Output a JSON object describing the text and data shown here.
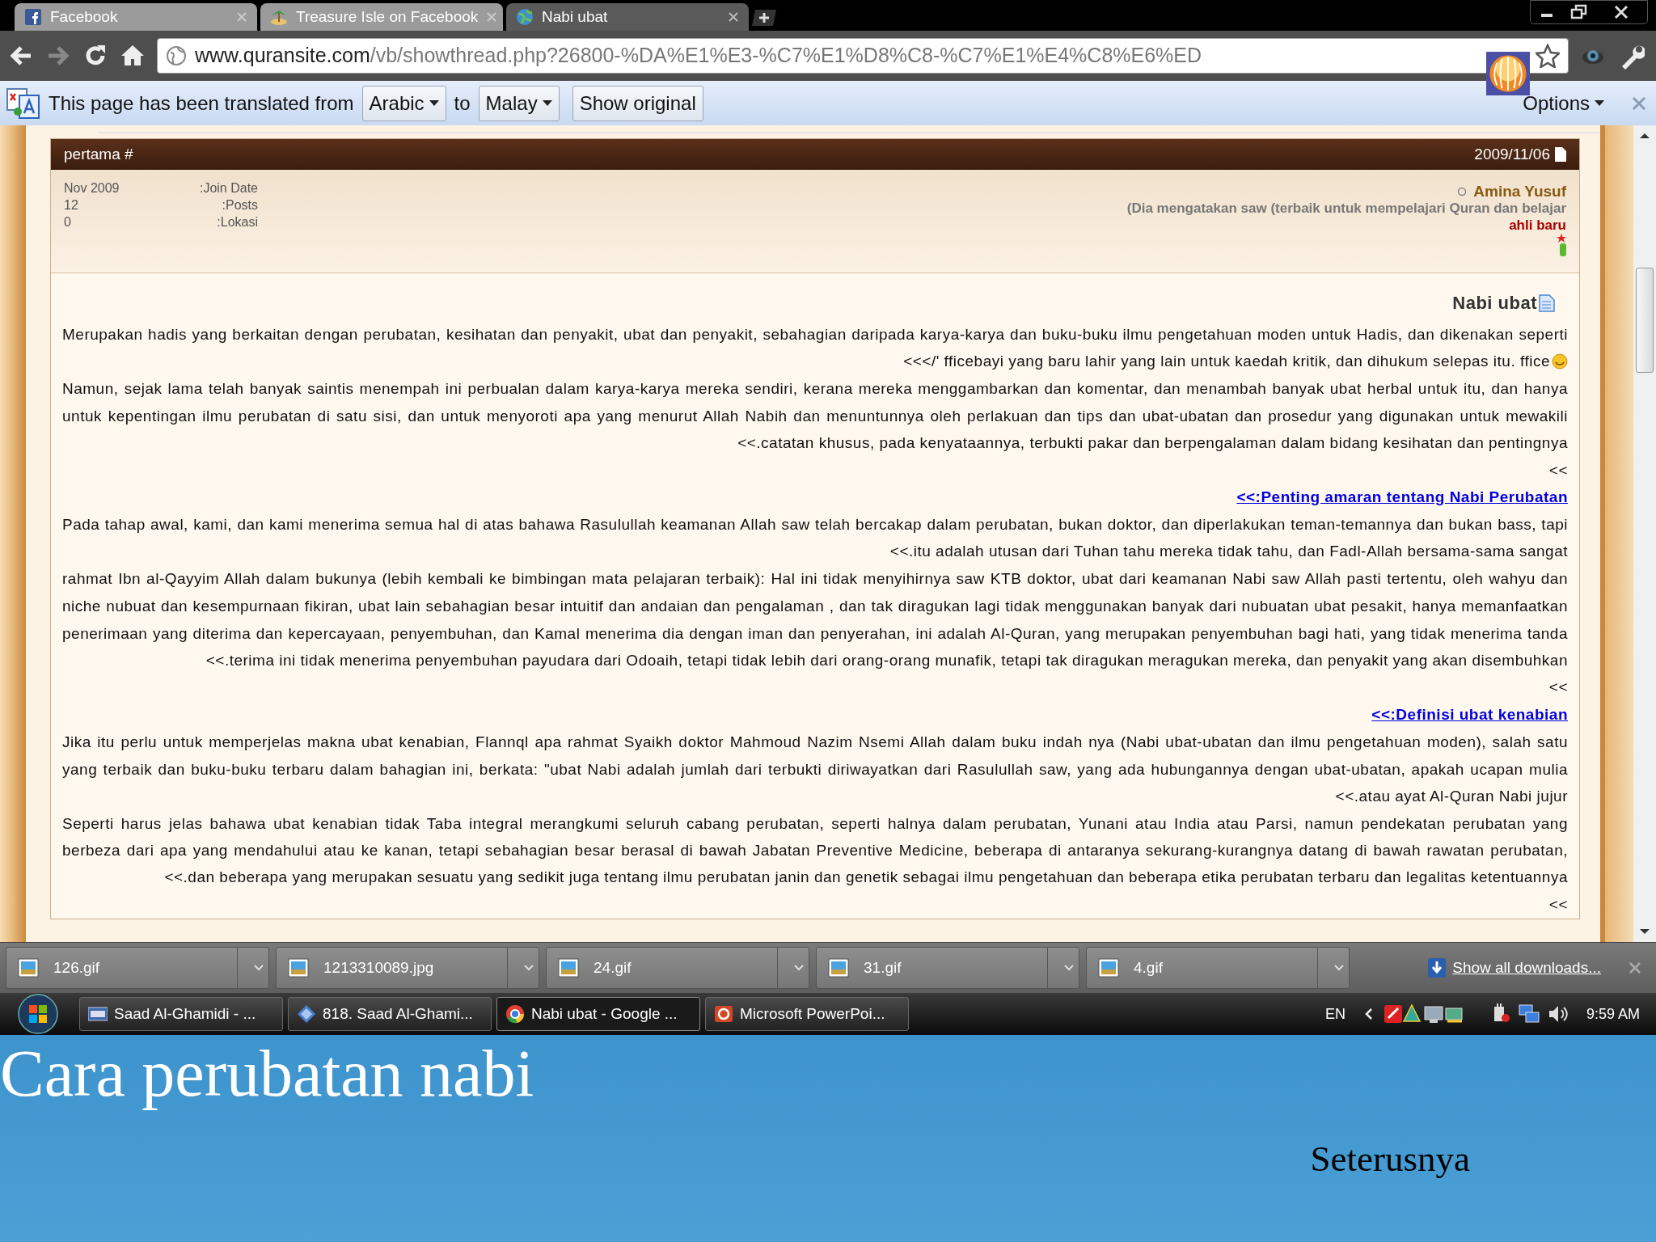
{
  "browser": {
    "tabs": [
      {
        "label": "Facebook",
        "selected": false
      },
      {
        "label": "Treasure Isle on Facebook",
        "selected": false
      },
      {
        "label": "Nabi ubat",
        "selected": true
      }
    ],
    "address": {
      "host": "www.quransite.com",
      "path": "/vb/showthread.php?26800-%DA%E1%E3-%C7%E1%D8%C8-%C7%E1%E4%C8%E6%ED"
    },
    "translate_bar": {
      "message": "This page has been translated from",
      "from": "Arabic",
      "connector": "to",
      "to": "Malay",
      "show_original": "Show original",
      "options": "Options"
    }
  },
  "post": {
    "number": "pertama #",
    "date": "2009/11/06",
    "user_info": [
      {
        "value": "Nov 2009",
        "label": ":Join Date"
      },
      {
        "value": "12",
        "label": ":Posts"
      },
      {
        "value": "0",
        "label": ":Lokasi"
      }
    ],
    "username": "Amina Yusuf",
    "user_title": "(Dia mengatakan saw (terbaik untuk mempelajari Quran dan belajar",
    "rank": "ahli baru",
    "title": "Nabi ubat",
    "lines": [
      {
        "kind": "full",
        "text": "Merupakan hadis yang berkaitan dengan perubatan, kesihatan dan penyakit, ubat dan penyakit, sebahagian daripada karya-karya dan buku-buku ilmu pengetahuan moden untuk Hadis, dan dikenakan seperti"
      },
      {
        "kind": "end",
        "text": "<<</' fficebayi yang baru lahir yang lain untuk kaedah kritik, dan dihukum selepas itu. ffice",
        "smiley": true
      },
      {
        "kind": "full",
        "text": "Namun, sejak lama telah banyak saintis menempah ini perbualan dalam karya-karya mereka sendiri, kerana mereka menggambarkan dan komentar, dan menambah banyak ubat herbal untuk itu, dan hanya"
      },
      {
        "kind": "full",
        "text": "untuk kepentingan ilmu perubatan di satu sisi, dan untuk menyoroti apa yang menurut Allah Nabih dan menuntunnya oleh perlakuan dan tips dan ubat-ubatan dan prosedur yang digunakan untuk mewakili"
      },
      {
        "kind": "end",
        "text": "<<.catatan khusus, pada kenyataannya, terbukti pakar dan berpengalaman dalam bidang kesihatan dan pentingnya"
      },
      {
        "kind": "end",
        "text": "<<"
      },
      {
        "kind": "link",
        "text": "<<:Penting amaran tentang Nabi Perubatan"
      },
      {
        "kind": "full",
        "text": "Pada tahap awal, kami, dan kami menerima semua hal di atas bahawa Rasulullah keamanan Allah saw telah bercakap dalam perubatan, bukan doktor, dan diperlakukan teman-temannya dan bukan bass, tapi"
      },
      {
        "kind": "end",
        "text": "<<.itu adalah utusan dari Tuhan tahu mereka tidak tahu, dan Fadl-Allah bersama-sama sangat"
      },
      {
        "kind": "full",
        "text": "rahmat Ibn al-Qayyim Allah dalam bukunya (lebih kembali ke bimbingan mata pelajaran terbaik): Hal ini tidak menyihirnya saw KTB doktor, ubat dari keamanan Nabi saw Allah pasti tertentu, oleh wahyu dan"
      },
      {
        "kind": "full",
        "text": "niche nubuat dan kesempurnaan fikiran, ubat lain sebahagian besar intuitif dan andaian dan pengalaman , dan tak diragukan lagi tidak menggunakan banyak dari nubuatan ubat pesakit, hanya memanfaatkan"
      },
      {
        "kind": "full",
        "text": "penerimaan yang diterima dan kepercayaan, penyembuhan, dan Kamal menerima dia dengan iman dan penyerahan, ini adalah Al-Quran, yang merupakan penyembuhan bagi hati, yang tidak menerima tanda"
      },
      {
        "kind": "end",
        "text": "<<.terima ini tidak menerima penyembuhan payudara dari Odoaih, tetapi tidak lebih dari orang-orang munafik, tetapi tak diragukan meragukan mereka, dan penyakit yang akan disembuhkan"
      },
      {
        "kind": "end",
        "text": "<<"
      },
      {
        "kind": "link",
        "text": "<<:Definisi ubat kenabian"
      },
      {
        "kind": "full",
        "text": "Jika itu perlu untuk memperjelas makna ubat kenabian, Flannql apa rahmat Syaikh doktor Mahmoud Nazim Nsemi Allah dalam buku indah nya (Nabi ubat-ubatan dan ilmu pengetahuan moden), salah satu"
      },
      {
        "kind": "full",
        "text": "yang terbaik dan buku-buku terbaru dalam bahagian ini, berkata: \"ubat Nabi adalah jumlah dari terbukti diriwayatkan dari Rasulullah saw, yang ada hubungannya dengan ubat-ubatan, apakah ucapan mulia"
      },
      {
        "kind": "end",
        "text": "<<.atau ayat Al-Quran Nabi jujur"
      },
      {
        "kind": "full",
        "text": "Seperti harus jelas bahawa ubat kenabian tidak Taba integral merangkumi seluruh cabang perubatan, seperti halnya dalam perubatan, Yunani atau India atau Parsi, namun pendekatan perubatan yang"
      },
      {
        "kind": "full",
        "text": "berbeza dari apa yang mendahului atau ke kanan, tetapi sebahagian besar berasal di bawah Jabatan Preventive Medicine, beberapa di antaranya sekurang-kurangnya datang di bawah rawatan perubatan,"
      },
      {
        "kind": "end",
        "text": "<<.dan beberapa yang merupakan sesuatu yang sedikit juga tentang ilmu perubatan janin dan genetik sebagai ilmu pengetahuan dan beberapa etika perubatan terbaru dan legalitas ketentuannya"
      },
      {
        "kind": "end",
        "text": "<<"
      }
    ]
  },
  "downloads": {
    "items": [
      "126.gif",
      "1213310089.jpg",
      "24.gif",
      "31.gif",
      "4.gif"
    ],
    "show_all": "Show all downloads..."
  },
  "taskbar": {
    "items": [
      {
        "label": "Saad Al-Ghamidi - ...",
        "selected": false
      },
      {
        "label": "818. Saad Al-Ghami...",
        "selected": false
      },
      {
        "label": "Nabi ubat - Google ...",
        "selected": true
      },
      {
        "label": "Microsoft PowerPoi...",
        "selected": false
      }
    ],
    "language": "EN",
    "time": "9:59 AM"
  },
  "slide": {
    "title": "Cara perubatan nabi",
    "next": "Seterusnya"
  }
}
